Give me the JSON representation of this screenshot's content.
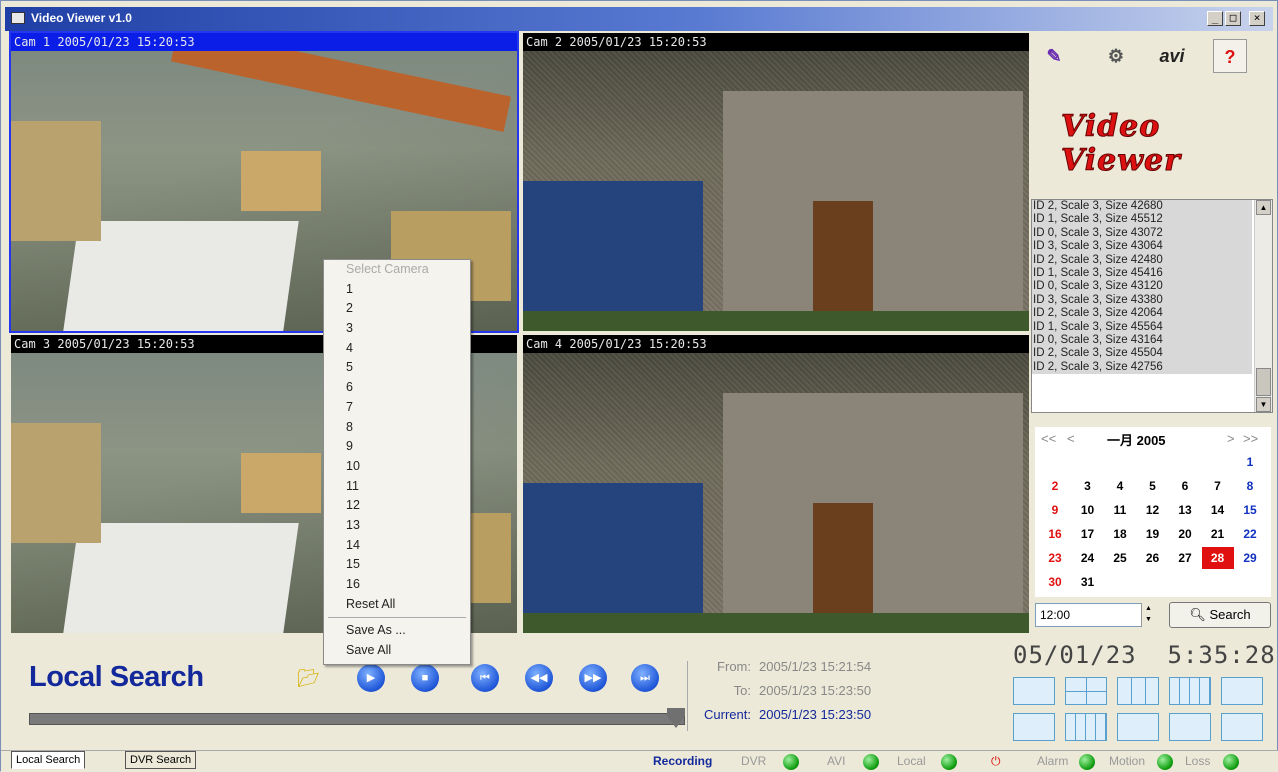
{
  "window": {
    "title": "Video Viewer v1.0",
    "controls": [
      "_",
      "□",
      "×"
    ]
  },
  "cameras": [
    {
      "label": "Cam 1 2005/01/23 15:20:53",
      "scene": "factory",
      "active": true
    },
    {
      "label": "Cam 2 2005/01/23 15:20:53",
      "scene": "room",
      "active": false
    },
    {
      "label": "Cam 3 2005/01/23 15:20:53",
      "scene": "factory",
      "active": false
    },
    {
      "label": "Cam 4 2005/01/23 15:20:53",
      "scene": "room",
      "active": false
    }
  ],
  "toolbar": {
    "edit_icon": "pencil-icon",
    "settings_icon": "gear-icon",
    "avi_label": "avi",
    "help_label": "?"
  },
  "logo": {
    "line1": "Video",
    "line2": "Viewer"
  },
  "log": [
    "ID 2, Scale 3, Size 42680",
    "ID 1, Scale 3, Size 45512",
    "ID 0, Scale 3, Size 43072",
    "ID 3, Scale 3, Size 43064",
    "ID 2, Scale 3, Size 42480",
    "ID 1, Scale 3, Size 45416",
    "ID 0, Scale 3, Size 43120",
    "ID 3, Scale 3, Size 43380",
    "ID 2, Scale 3, Size 42064",
    "ID 1, Scale 3, Size 45564",
    "ID 0, Scale 3, Size 43164",
    "ID 2, Scale 3, Size 45504",
    "ID 2, Scale 3, Size 42756"
  ],
  "calendar": {
    "month_label": "一月 2005",
    "prev_year": "<<",
    "prev": "<",
    "next": ">",
    "next_year": ">>",
    "weeks": [
      [
        "",
        "",
        "",
        "",
        "",
        "",
        "1"
      ],
      [
        "2",
        "3",
        "4",
        "5",
        "6",
        "7",
        "8"
      ],
      [
        "9",
        "10",
        "11",
        "12",
        "13",
        "14",
        "15"
      ],
      [
        "16",
        "17",
        "18",
        "19",
        "20",
        "21",
        "22"
      ],
      [
        "23",
        "24",
        "25",
        "26",
        "27",
        "28",
        "29"
      ],
      [
        "30",
        "31",
        "",
        "",
        "",
        "",
        ""
      ]
    ],
    "selected": "28"
  },
  "time_input": "12:00",
  "search_button": "Search",
  "context_menu": {
    "header": "Select Camera",
    "items": [
      "1",
      "2",
      "3",
      "4",
      "5",
      "6",
      "7",
      "8",
      "9",
      "10",
      "11",
      "12",
      "13",
      "14",
      "15",
      "16",
      "Reset All"
    ],
    "items2": [
      "Save As ...",
      "Save All"
    ]
  },
  "bottom": {
    "title": "Local Search",
    "from_label": "From:",
    "from_value": "2005/1/23 15:21:54",
    "to_label": "To:",
    "to_value": "2005/1/23 15:23:50",
    "current_label": "Current:",
    "current_value": "2005/1/23 15:23:50",
    "clock_date": "05/01/23",
    "clock_time": "5:35:28"
  },
  "tabs": [
    "Local Search",
    "DVR Search"
  ],
  "status": {
    "recording": "Recording",
    "dvr": "DVR",
    "avi": "AVI",
    "local": "Local",
    "alarm": "Alarm",
    "motion": "Motion",
    "loss": "Loss"
  },
  "colors": {
    "accent": "#13289a",
    "active_cam_bar": "#0b1ee8",
    "selected_day": "#e01010"
  }
}
